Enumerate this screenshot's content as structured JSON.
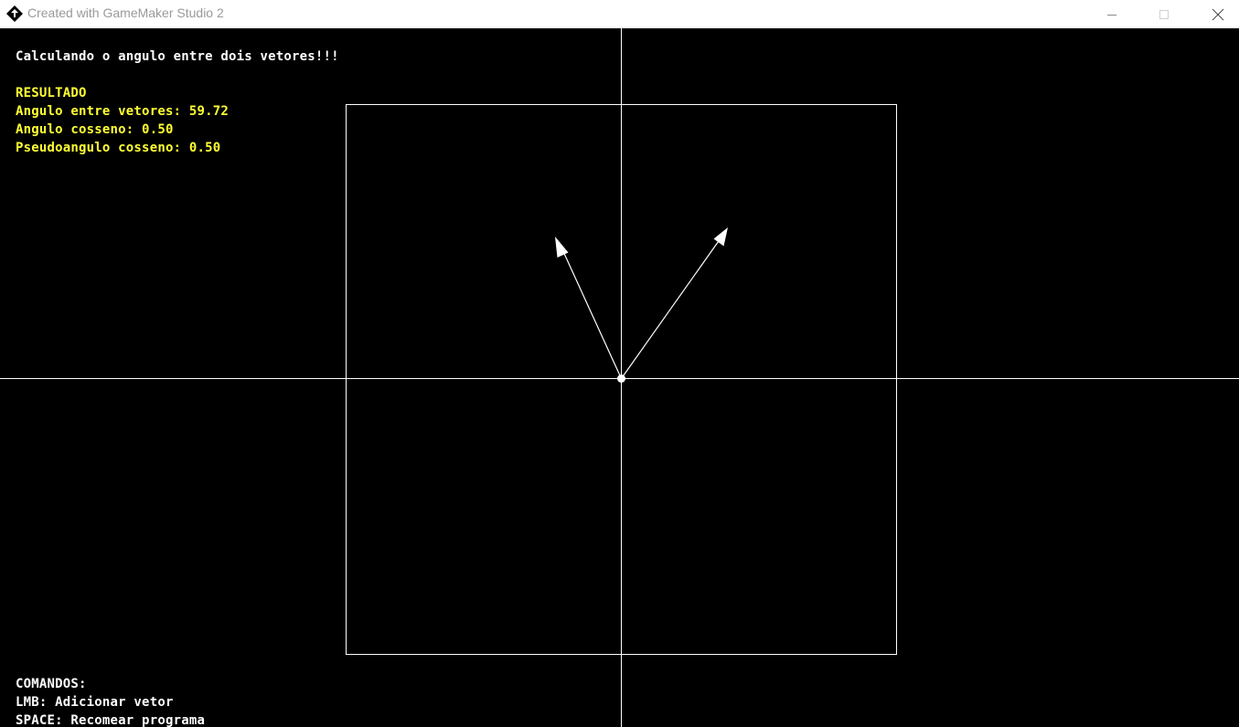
{
  "window": {
    "title": "Created with GameMaker Studio 2",
    "app_icon": "gamemaker-icon",
    "controls": [
      "minimize-icon",
      "maximize-icon",
      "close-icon"
    ]
  },
  "hud": {
    "heading": "Calculando o angulo entre dois vetores!!!",
    "result_title": "RESULTADO",
    "angle_between": "Angulo entre vetores: 59.72",
    "cos_angle": "Angulo cosseno: 0.50",
    "pseudo_cos": "Pseudoangulo cosseno: 0.50",
    "commands_title": "COMANDOS:",
    "cmd_lmb": "LMB: Adicionar vetor",
    "cmd_space": "SPACE: Recomear programa"
  },
  "colors": {
    "background": "#000000",
    "lines": "#ffffff",
    "result_text": "#ffff33",
    "info_text": "#ffffff"
  }
}
